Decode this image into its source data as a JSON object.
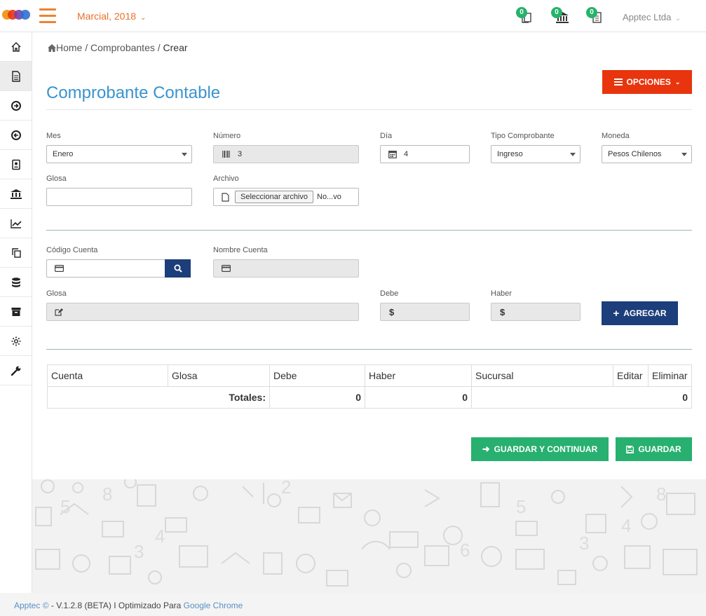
{
  "header": {
    "company_label": "Marcial, 2018",
    "notifications": [
      {
        "count": "0",
        "icon": "documents-icon"
      },
      {
        "count": "0",
        "icon": "bank-icon"
      },
      {
        "count": "0",
        "icon": "invoice-icon"
      }
    ],
    "user_label": "Apptec Ltda"
  },
  "sidebar": {
    "items": [
      "home-icon",
      "document-icon",
      "arrow-right-circle-icon",
      "arrow-left-circle-icon",
      "contact-card-icon",
      "bank-icon",
      "chart-line-icon",
      "copy-icon",
      "database-icon",
      "archive-icon",
      "gear-icon",
      "wrench-icon"
    ]
  },
  "breadcrumb": {
    "home": "Home",
    "sep1": " / ",
    "middle": "Comprobantes",
    "sep2": " / ",
    "current": "Crear"
  },
  "page": {
    "title": "Comprobante Contable",
    "opciones_label": "OPCIONES"
  },
  "form": {
    "mes": {
      "label": "Mes",
      "value": "Enero"
    },
    "numero": {
      "label": "Número",
      "value": "3"
    },
    "dia": {
      "label": "Día",
      "value": "4"
    },
    "tipo": {
      "label": "Tipo Comprobante",
      "value": "Ingreso"
    },
    "moneda": {
      "label": "Moneda",
      "value": "Pesos Chilenos"
    },
    "glosa": {
      "label": "Glosa",
      "value": ""
    },
    "archivo": {
      "label": "Archivo",
      "button": "Seleccionar archivo",
      "value": "No...vo"
    },
    "codigo_cuenta": {
      "label": "Código Cuenta",
      "value": ""
    },
    "nombre_cuenta": {
      "label": "Nombre Cuenta",
      "value": ""
    },
    "glosa_linea": {
      "label": "Glosa",
      "value": ""
    },
    "debe": {
      "label": "Debe",
      "prefix": "$"
    },
    "haber": {
      "label": "Haber",
      "prefix": "$"
    },
    "agregar_label": "AGREGAR"
  },
  "table": {
    "headers": [
      "Cuenta",
      "Glosa",
      "Debe",
      "Haber",
      "Sucursal",
      "Editar",
      "Eliminar"
    ],
    "totals_label": "Totales:",
    "totals": [
      "0",
      "0",
      "0"
    ]
  },
  "actions": {
    "guardar_continuar": "GUARDAR Y CONTINUAR",
    "guardar": "GUARDAR"
  },
  "footer": {
    "brand": "Apptec ©",
    "text": " - V.1.2.8 (BETA) I Optimizado Para ",
    "browser": "Google Chrome"
  },
  "colors": {
    "accent_orange": "#e8702a",
    "title_blue": "#3a93cf",
    "danger": "#e8350e",
    "navy": "#1c3e7a",
    "green": "#27b06f"
  }
}
